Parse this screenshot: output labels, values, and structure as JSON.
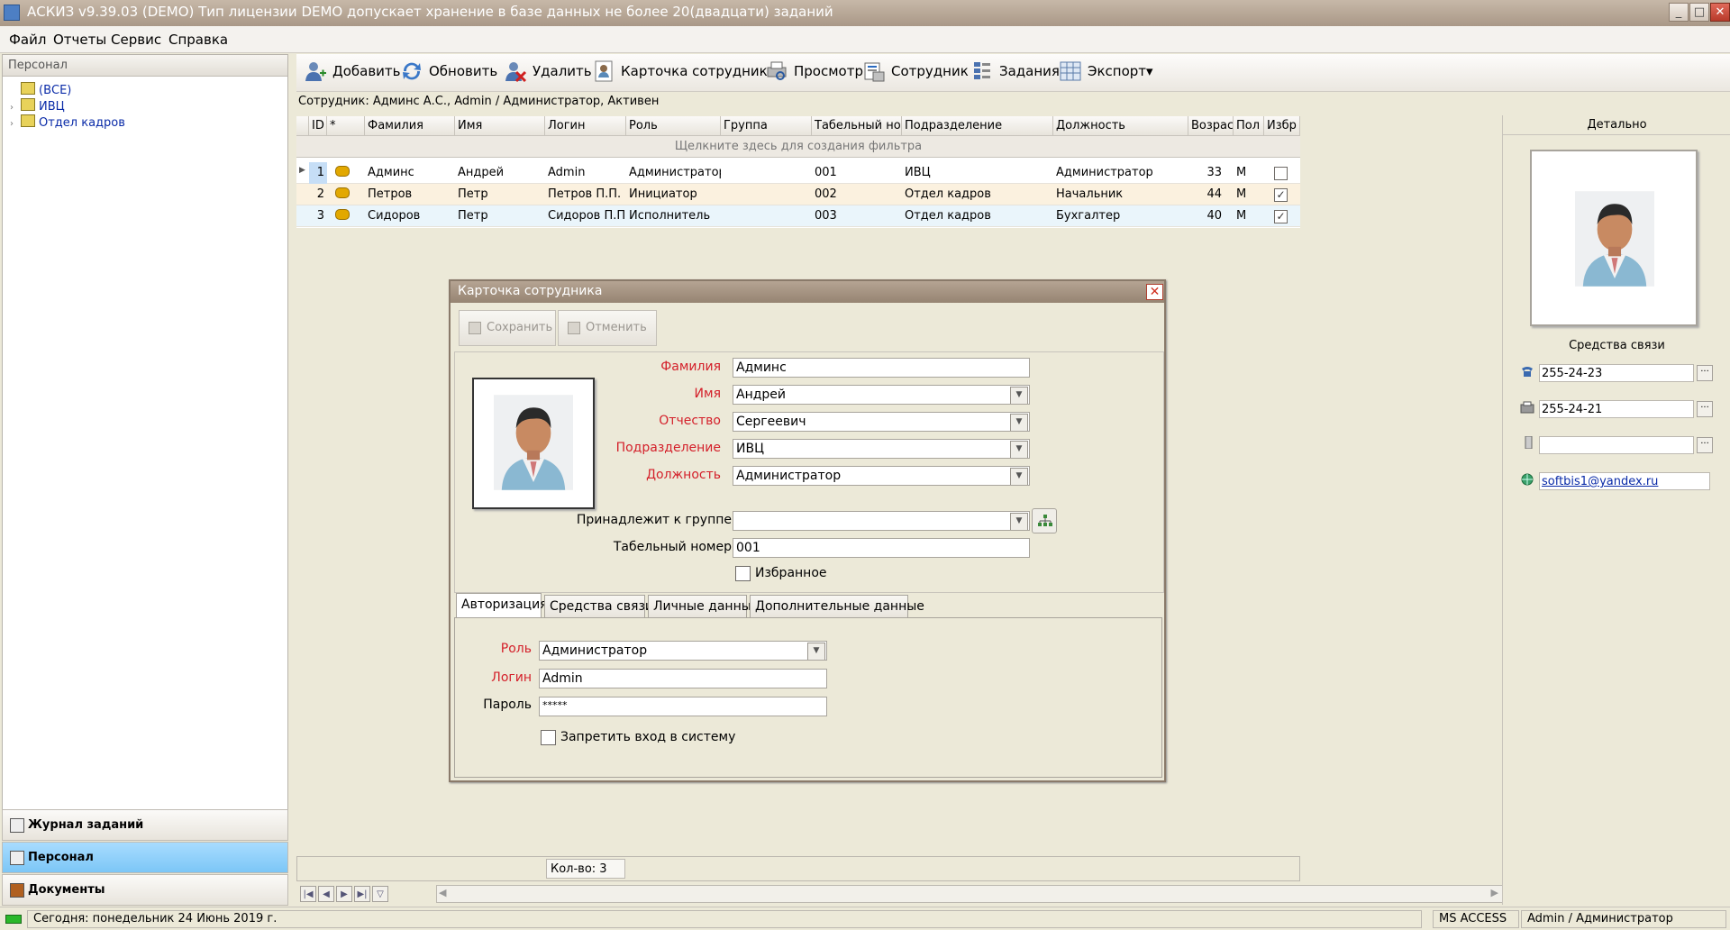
{
  "window": {
    "title": "АСКИЗ v9.39.03 (DEMO) Тип лицензии DEMO допускает хранение в базе данных не более 20(двадцати) заданий",
    "min_symbol": "_",
    "max_symbol": "□",
    "close_symbol": "✕"
  },
  "menu": [
    "Файл",
    "Отчеты",
    "Сервис",
    "Справка"
  ],
  "left_panel": {
    "header": "Персонал",
    "tree": [
      {
        "label": "(ВСЕ)",
        "expander": "",
        "selected": true
      },
      {
        "label": "ИВЦ",
        "expander": "›"
      },
      {
        "label": "Отдел кадров",
        "expander": "›"
      }
    ],
    "nav": [
      {
        "label": "Журнал заданий",
        "icon": "journal-icon",
        "active": false
      },
      {
        "label": "Персонал",
        "icon": "people-icon",
        "active": true
      },
      {
        "label": "Документы",
        "icon": "documents-icon",
        "active": false
      }
    ]
  },
  "toolbar": {
    "add": "Добавить",
    "refresh": "Обновить",
    "delete": "Удалить",
    "card": "Карточка сотрудника",
    "preview": "Просмотр",
    "employee": "Сотрудник",
    "tasks": "Задания",
    "export": "Экспорт▾"
  },
  "status_line": "Сотрудник: Админс А.С., Admin / Администратор,  Активен",
  "grid": {
    "columns": [
      "",
      "ID",
      "*",
      "Фамилия",
      "Имя",
      "Логин",
      "Роль",
      "Группа",
      "Табельный номер",
      "Подразделение",
      "Должность",
      "Возраст",
      "Пол",
      "Избр"
    ],
    "filter_hint": "Щелкните здесь для создания фильтра",
    "rows": [
      {
        "id": "1",
        "last": "Админс",
        "first": "Андрей",
        "login": "Admin",
        "role": "Администратор",
        "group": "",
        "tab": "001",
        "dept": "ИВЦ",
        "pos": "Администратор",
        "age": "33",
        "sex": "М",
        "fav": "",
        "marker": "▶"
      },
      {
        "id": "2",
        "last": "Петров",
        "first": "Петр",
        "login": "Петров П.П.",
        "role": "Инициатор",
        "group": "",
        "tab": "002",
        "dept": "Отдел кадров",
        "pos": "Начальник",
        "age": "44",
        "sex": "М",
        "fav": "✓",
        "marker": ""
      },
      {
        "id": "3",
        "last": "Сидоров",
        "first": "Петр",
        "login": "Сидоров П.П.",
        "role": "Исполнитель",
        "group": "",
        "tab": "003",
        "dept": "Отдел кадров",
        "pos": "Бухгалтер",
        "age": "40",
        "sex": "М",
        "fav": "✓",
        "marker": ""
      }
    ]
  },
  "count_label": "Кол-во: 3",
  "right_panel": {
    "header": "Детально",
    "contacts_title": "Средства связи",
    "contacts": [
      {
        "icon": "phone-icon",
        "value": "255-24-23"
      },
      {
        "icon": "fax-icon",
        "value": "255-24-21"
      },
      {
        "icon": "mobile-icon",
        "value": ""
      },
      {
        "icon": "globe-icon",
        "value": "softbis1@yandex.ru"
      }
    ]
  },
  "dialog": {
    "title": "Карточка сотрудника",
    "save": "Сохранить",
    "cancel": "Отменить",
    "fields": {
      "last_label": "Фамилия",
      "last_value": "Админс",
      "first_label": "Имя",
      "first_value": "Андрей",
      "middle_label": "Отчество",
      "middle_value": "Сергеевич",
      "dept_label": "Подразделение",
      "dept_value": "ИВЦ",
      "pos_label": "Должность",
      "pos_value": "Администратор",
      "group_label": "Принадлежит к группе",
      "group_value": "",
      "tab_label": "Табельный номер",
      "tab_value": "001",
      "fav_label": "Избранное"
    },
    "tabs": [
      "Авторизация",
      "Средства связи",
      "Личные данные",
      "Дополнительные данные"
    ],
    "auth": {
      "role_label": "Роль",
      "role_value": "Администратор",
      "login_label": "Логин",
      "login_value": "Admin",
      "password_label": "Пароль",
      "password_value": "*****",
      "deny_label": "Запретить вход в систему"
    }
  },
  "statusbar": {
    "today": "Сегодня: понедельник 24 Июнь 2019 г.",
    "db": "MS ACCESS",
    "user": "Admin / Администратор"
  },
  "colors": {
    "required": "#d4202a",
    "active_nav": "#7cc6f6",
    "link": "#0a2ba8"
  }
}
